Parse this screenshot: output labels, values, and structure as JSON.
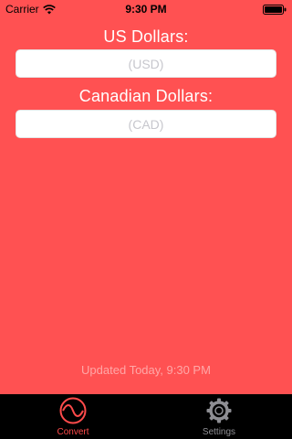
{
  "status_bar": {
    "carrier": "Carrier",
    "time": "9:30 PM",
    "icons": [
      "wifi-icon",
      "battery-icon"
    ]
  },
  "converter": {
    "usd_label": "US Dollars:",
    "usd_placeholder": "(USD)",
    "usd_value": "",
    "cad_label": "Canadian Dollars:",
    "cad_placeholder": "(CAD)",
    "cad_value": ""
  },
  "footer": {
    "updated_text": "Updated Today, 9:30 PM"
  },
  "tab_bar": {
    "tabs": [
      {
        "label": "Convert",
        "icon": "convert-wave-icon",
        "selected": true
      },
      {
        "label": "Settings",
        "icon": "gear-icon",
        "selected": false
      }
    ]
  },
  "colors": {
    "background": "#ff5152",
    "accent": "#ff4b4b",
    "tab_bar": "#000000",
    "inactive_tab": "#8e8e93"
  }
}
